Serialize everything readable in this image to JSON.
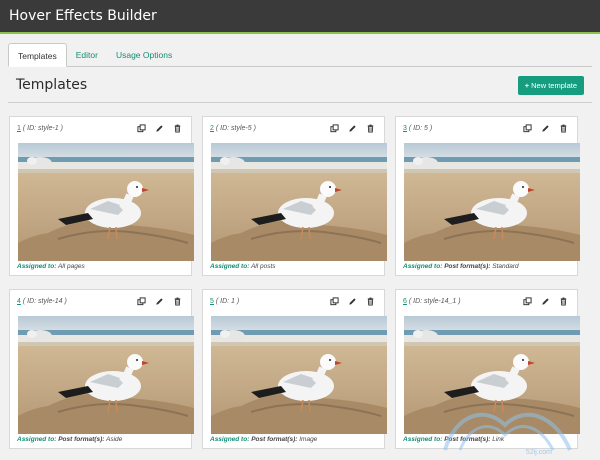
{
  "app": {
    "title": "Hover Effects Builder"
  },
  "tabs": [
    {
      "label": "Templates"
    },
    {
      "label": "Editor"
    },
    {
      "label": "Usage Options"
    }
  ],
  "page": {
    "heading": "Templates"
  },
  "new_button": {
    "label": "New template",
    "icon": "plus-icon"
  },
  "templates": [
    {
      "num": "1",
      "id_text": "( ID: style-1 )",
      "assigned_label": "Assigned to:",
      "assigned_strong": "",
      "assigned_rest": "All pages"
    },
    {
      "num": "2",
      "id_text": "( ID: style-5 )",
      "assigned_label": "Assigned to:",
      "assigned_strong": "",
      "assigned_rest": "All posts"
    },
    {
      "num": "3",
      "id_text": "( ID: 5 )",
      "assigned_label": "Assigned to:",
      "assigned_strong": "Post format(s):",
      "assigned_rest": "Standard"
    },
    {
      "num": "4",
      "id_text": "( ID: style-14 )",
      "assigned_label": "Assigned to:",
      "assigned_strong": "Post format(s):",
      "assigned_rest": "Aside"
    },
    {
      "num": "5",
      "id_text": "( ID: 1 )",
      "assigned_label": "Assigned to:",
      "assigned_strong": "Post format(s):",
      "assigned_rest": "Image"
    },
    {
      "num": "6",
      "id_text": "( ID: style-14_1 )",
      "assigned_label": "Assigned to:",
      "assigned_strong": "Post format(s):",
      "assigned_rest": "Link"
    }
  ],
  "card_icons": [
    "copy-icon",
    "pencil-icon",
    "trash-icon"
  ],
  "watermark": {
    "text": "52ij.com"
  },
  "colors": {
    "accent": "#169d80",
    "titlebar": "#3a3a3a",
    "titlebar_border": "#8bc34a"
  }
}
